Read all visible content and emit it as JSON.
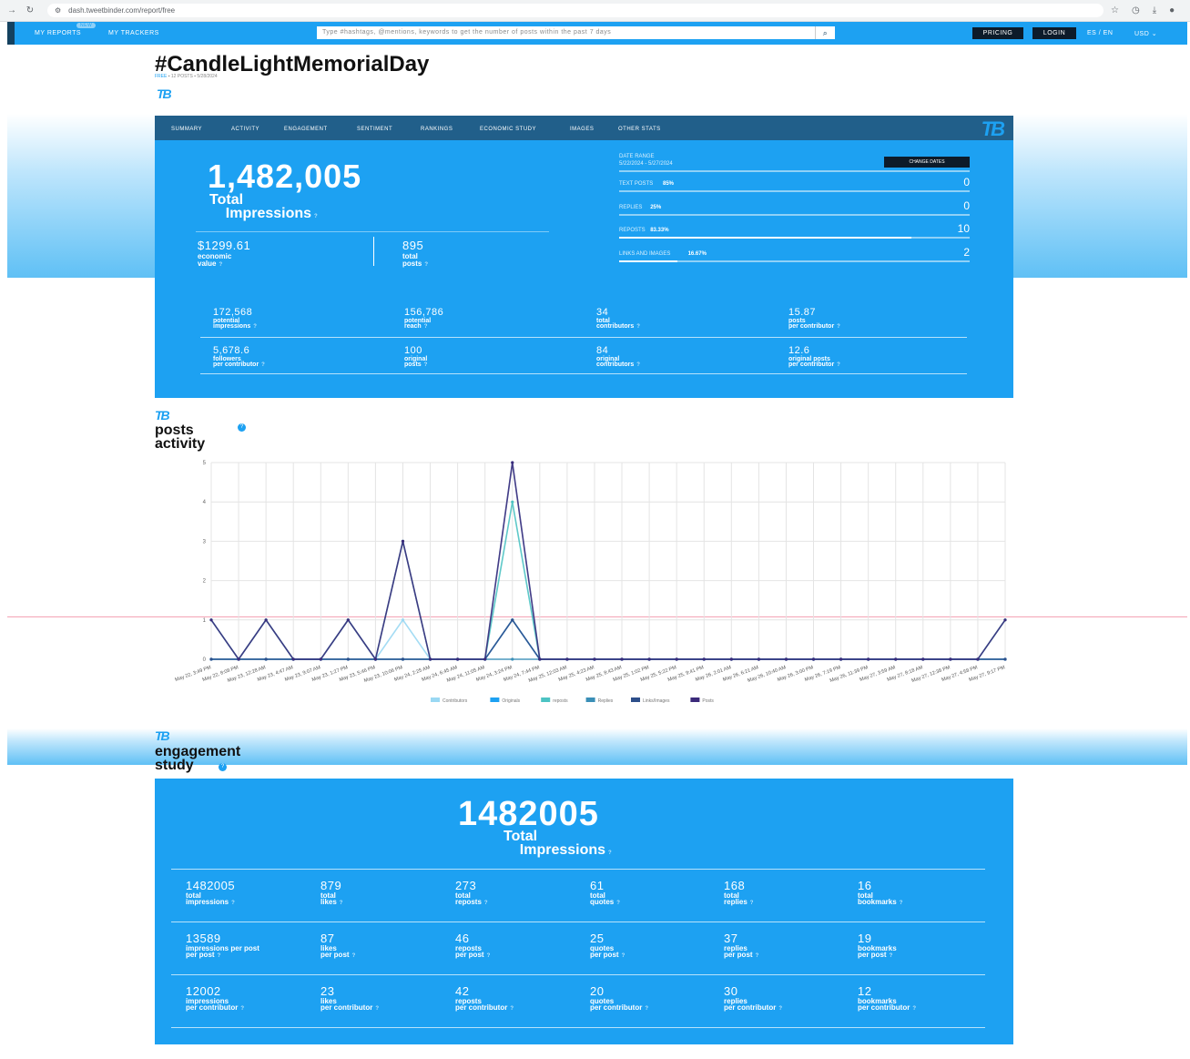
{
  "browser": {
    "url": "dash.tweetbinder.com/report/free"
  },
  "nav": {
    "my_reports": "MY REPORTS",
    "my_reports_badge": "NEW",
    "my_trackers": "MY TRACKERS",
    "search_placeholder": "Type #hashtags, @mentions, keywords to get the number of posts within the past 7 days",
    "pricing": "PRICING",
    "login": "LOGIN",
    "language": "ES / EN",
    "currency": "USD"
  },
  "report": {
    "title": "#CandleLightMemorialDay",
    "plan": "FREE",
    "posts_count": "12 POSTS",
    "date": "5/28/2024"
  },
  "tabs": [
    "SUMMARY",
    "ACTIVITY",
    "ENGAGEMENT",
    "SENTIMENT",
    "RANKINGS",
    "ECONOMIC STUDY",
    "IMAGES",
    "OTHER STATS"
  ],
  "summary": {
    "impressions": "1,482,005",
    "impressions_label_1": "Total",
    "impressions_label_2": "Impressions",
    "economic_value": "$1299.61",
    "economic_label_1": "economic",
    "economic_label_2": "value",
    "total_posts": "895",
    "total_posts_label_1": "total",
    "total_posts_label_2": "posts",
    "date_range_label": "DATE RANGE",
    "date_range": "5/22/2024 - 5/27/2024",
    "change_dates": "CHANGE DATES",
    "breakdown": [
      {
        "label": "TEXT POSTS",
        "pct": "85%",
        "value": "0",
        "fill": 0.0
      },
      {
        "label": "REPLIES",
        "pct": "25%",
        "value": "0",
        "fill": 0.0
      },
      {
        "label": "REPOSTS",
        "pct": "83.33%",
        "value": "10",
        "fill": 0.8333
      },
      {
        "label": "LINKS AND IMAGES",
        "pct": "16.67%",
        "value": "2",
        "fill": 0.1667
      }
    ],
    "stats": [
      {
        "value": "172,568",
        "l1": "potential",
        "l2": "impressions"
      },
      {
        "value": "156,786",
        "l1": "potential",
        "l2": "reach"
      },
      {
        "value": "34",
        "l1": "total",
        "l2": "contributors"
      },
      {
        "value": "15.87",
        "l1": "posts",
        "l2": "per contributor"
      },
      {
        "value": "5,678.6",
        "l1": "followers",
        "l2": "per contributor"
      },
      {
        "value": "100",
        "l1": "original",
        "l2": "posts"
      },
      {
        "value": "84",
        "l1": "original",
        "l2": "contributors"
      },
      {
        "value": "12.6",
        "l1": "original posts",
        "l2": "per contributor"
      }
    ]
  },
  "activity": {
    "title_1": "posts",
    "title_2": "activity"
  },
  "chart_data": {
    "type": "line",
    "ylim": [
      0,
      5
    ],
    "yticks": [
      "0",
      "1",
      "2",
      "3",
      "4",
      "5"
    ],
    "x": [
      "May 22, 3:49 PM",
      "May 22, 8:08 PM",
      "May 23, 12:28 AM",
      "May 23, 4:47 AM",
      "May 23, 9:07 AM",
      "May 23, 1:27 PM",
      "May 23, 5:46 PM",
      "May 23, 10:06 PM",
      "May 24, 2:25 AM",
      "May 24, 6:45 AM",
      "May 24, 11:05 AM",
      "May 24, 3:24 PM",
      "May 24, 7:44 PM",
      "May 25, 12:03 AM",
      "May 25, 4:23 AM",
      "May 25, 8:43 AM",
      "May 25, 1:02 PM",
      "May 25, 5:22 PM",
      "May 25, 9:41 PM",
      "May 26, 2:01 AM",
      "May 26, 6:21 AM",
      "May 26, 10:40 AM",
      "May 26, 3:00 PM",
      "May 26, 7:19 PM",
      "May 26, 11:39 PM",
      "May 27, 3:59 AM",
      "May 27, 8:18 AM",
      "May 27, 12:38 PM",
      "May 27, 4:58 PM",
      "May 27, 9:17 PM"
    ],
    "series": [
      {
        "name": "Contributors",
        "color": "#9ad8f3",
        "values": [
          1,
          0,
          1,
          0,
          0,
          1,
          0,
          1,
          0,
          0,
          0,
          5,
          0,
          0,
          0,
          0,
          0,
          0,
          0,
          0,
          0,
          0,
          0,
          0,
          0,
          0,
          0,
          0,
          0,
          1
        ]
      },
      {
        "name": "Originals",
        "color": "#1da1f2",
        "values": [
          0,
          0,
          0,
          0,
          0,
          0,
          0,
          0,
          0,
          0,
          0,
          1,
          0,
          0,
          0,
          0,
          0,
          0,
          0,
          0,
          0,
          0,
          0,
          0,
          0,
          0,
          0,
          0,
          0,
          0
        ]
      },
      {
        "name": "reposts",
        "color": "#4cc3c3",
        "values": [
          1,
          0,
          1,
          0,
          0,
          1,
          0,
          3,
          0,
          0,
          0,
          4,
          0,
          0,
          0,
          0,
          0,
          0,
          0,
          0,
          0,
          0,
          0,
          0,
          0,
          0,
          0,
          0,
          0,
          1
        ]
      },
      {
        "name": "Replies",
        "color": "#3a8fb7",
        "values": [
          0,
          0,
          0,
          0,
          0,
          0,
          0,
          0,
          0,
          0,
          0,
          0,
          0,
          0,
          0,
          0,
          0,
          0,
          0,
          0,
          0,
          0,
          0,
          0,
          0,
          0,
          0,
          0,
          0,
          0
        ]
      },
      {
        "name": "Links/Images",
        "color": "#2d4f8a",
        "values": [
          0,
          0,
          0,
          0,
          0,
          0,
          0,
          0,
          0,
          0,
          0,
          1,
          0,
          0,
          0,
          0,
          0,
          0,
          0,
          0,
          0,
          0,
          0,
          0,
          0,
          0,
          0,
          0,
          0,
          0
        ]
      },
      {
        "name": "Posts",
        "color": "#3b2a7a",
        "values": [
          1,
          0,
          1,
          0,
          0,
          1,
          0,
          3,
          0,
          0,
          0,
          5,
          0,
          0,
          0,
          0,
          0,
          0,
          0,
          0,
          0,
          0,
          0,
          0,
          0,
          0,
          0,
          0,
          0,
          1
        ]
      }
    ]
  },
  "engagement": {
    "title_1": "engagement",
    "title_2": "study",
    "impressions": "1482005",
    "label_1": "Total",
    "label_2": "Impressions",
    "rows": [
      [
        {
          "value": "1482005",
          "l1": "total",
          "l2": "impressions"
        },
        {
          "value": "879",
          "l1": "total",
          "l2": "likes"
        },
        {
          "value": "273",
          "l1": "total",
          "l2": "reposts"
        },
        {
          "value": "61",
          "l1": "total",
          "l2": "quotes"
        },
        {
          "value": "168",
          "l1": "total",
          "l2": "replies"
        },
        {
          "value": "16",
          "l1": "total",
          "l2": "bookmarks"
        }
      ],
      [
        {
          "value": "13589",
          "l1": "impressions per post",
          "l2": "per post"
        },
        {
          "value": "87",
          "l1": "likes",
          "l2": "per post"
        },
        {
          "value": "46",
          "l1": "reposts",
          "l2": "per post"
        },
        {
          "value": "25",
          "l1": "quotes",
          "l2": "per post"
        },
        {
          "value": "37",
          "l1": "replies",
          "l2": "per post"
        },
        {
          "value": "19",
          "l1": "bookmarks",
          "l2": "per post"
        }
      ],
      [
        {
          "value": "12002",
          "l1": "impressions",
          "l2": "per contributor"
        },
        {
          "value": "23",
          "l1": "likes",
          "l2": "per contributor"
        },
        {
          "value": "42",
          "l1": "reposts",
          "l2": "per contributor"
        },
        {
          "value": "20",
          "l1": "quotes",
          "l2": "per contributor"
        },
        {
          "value": "30",
          "l1": "replies",
          "l2": "per contributor"
        },
        {
          "value": "12",
          "l1": "bookmarks",
          "l2": "per contributor"
        }
      ]
    ]
  },
  "colors": {
    "brand": "#1da1f2",
    "dark": "#0d1b2a",
    "tabs_bar": "#215f8a"
  }
}
